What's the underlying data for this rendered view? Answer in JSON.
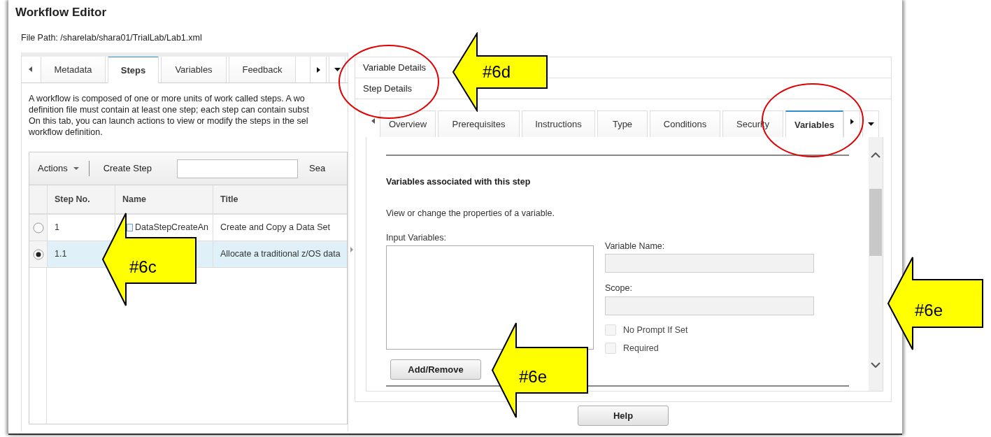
{
  "window": {
    "title": "Workflow Editor",
    "file_path": "File Path: /sharelab/shara01/TrialLab/Lab1.xml"
  },
  "left_tabs": [
    {
      "label": "Metadata",
      "selected": false
    },
    {
      "label": "Steps",
      "selected": true
    },
    {
      "label": "Variables",
      "selected": false
    },
    {
      "label": "Feedback",
      "selected": false
    }
  ],
  "steps_tab": {
    "description_lines": [
      "A workflow is composed of one or more units of work called steps. A wo",
      "definition file must contain at least one step; each step can contain subst",
      "On this tab, you can launch actions to view or modify the steps in the sel",
      "workflow definition."
    ],
    "toolbar": {
      "actions": "Actions",
      "create": "Create Step",
      "search_label": "Sea"
    },
    "table": {
      "columns": [
        "Step No.",
        "Name",
        "Title"
      ],
      "rows": [
        {
          "selected": false,
          "step_no": "1",
          "name": "DataStepCreateAn",
          "title": "Create and Copy a Data Set"
        },
        {
          "selected": true,
          "step_no": "1.1",
          "title": "Allocate a traditional z/OS data"
        }
      ]
    }
  },
  "detail_sections": [
    "Variable Details",
    "Step Details"
  ],
  "step_tabs": [
    {
      "label": "Overview",
      "selected": false
    },
    {
      "label": "Prerequisites",
      "selected": false
    },
    {
      "label": "Instructions",
      "selected": false
    },
    {
      "label": "Type",
      "selected": false
    },
    {
      "label": "Conditions",
      "selected": false
    },
    {
      "label": "Security",
      "selected": false
    },
    {
      "label": "Variables",
      "selected": true
    }
  ],
  "variables_panel": {
    "heading": "Variables associated with this step",
    "description": "View or change the properties of a variable.",
    "input_variables_label": "Input Variables:",
    "variable_name_label": "Variable Name:",
    "scope_label": "Scope:",
    "checkboxes": [
      {
        "label": "No Prompt If Set",
        "checked": false,
        "disabled": true
      },
      {
        "label": "Required",
        "checked": false,
        "disabled": true
      }
    ],
    "add_remove": "Add/Remove"
  },
  "help_button": "Help",
  "annotations": [
    {
      "kind": "ellipse"
    },
    {
      "kind": "ellipse"
    },
    {
      "kind": "arrow",
      "label": "#6c"
    },
    {
      "kind": "arrow",
      "label": "#6d"
    },
    {
      "kind": "arrow",
      "label": "#6e"
    },
    {
      "kind": "arrow",
      "label": "#6e"
    }
  ]
}
